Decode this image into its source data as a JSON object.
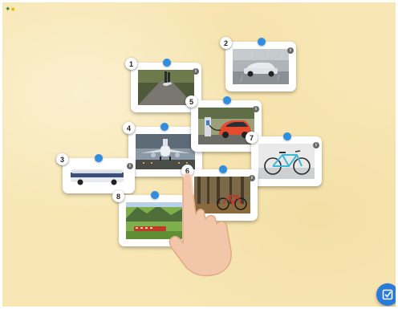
{
  "toolbar": {
    "icons": [
      "puzzle-icon",
      "lightbulb-icon"
    ]
  },
  "cards": [
    {
      "number": "1",
      "subject": "runner on road"
    },
    {
      "number": "2",
      "subject": "car in rain"
    },
    {
      "number": "3",
      "subject": "bus"
    },
    {
      "number": "4",
      "subject": "airplane"
    },
    {
      "number": "5",
      "subject": "electric car charging"
    },
    {
      "number": "6",
      "subject": "bicycle in forest"
    },
    {
      "number": "7",
      "subject": "blue bicycle"
    },
    {
      "number": "8",
      "subject": "mountain train"
    }
  ],
  "info_glyph": "i",
  "colors": {
    "background": "#f8e7b5",
    "pin": "#2f8ee0",
    "fab": "#2a7bd9"
  },
  "fab": {
    "icon": "edit-check-icon"
  }
}
